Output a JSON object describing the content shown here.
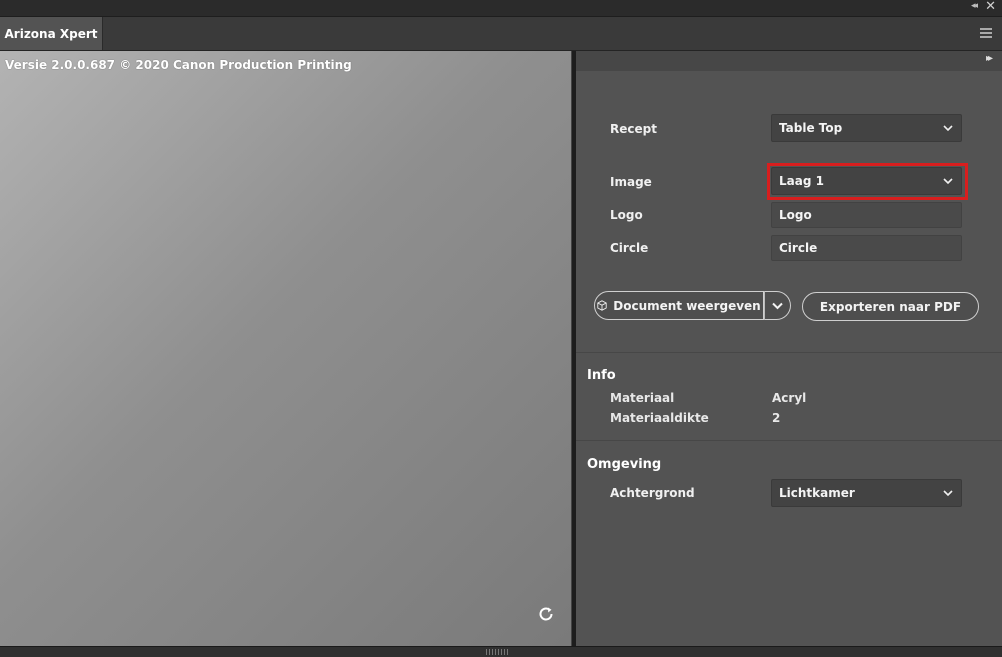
{
  "app": {
    "tab_title": "Arizona Xpert",
    "version_text": "Versie 2.0.0.687 © 2020 Canon Production Printing"
  },
  "form": {
    "recept": {
      "label": "Recept",
      "value": "Table Top"
    },
    "image": {
      "label": "Image",
      "value": "Laag 1"
    },
    "logo": {
      "label": "Logo",
      "value": "Logo"
    },
    "circle": {
      "label": "Circle",
      "value": "Circle"
    }
  },
  "actions": {
    "document_button": "Document weergeven",
    "export_button": "Exporteren naar PDF"
  },
  "info": {
    "heading": "Info",
    "rows": [
      {
        "key": "Materiaal",
        "value": "Acryl"
      },
      {
        "key": "Materiaaldikte",
        "value": "2"
      }
    ]
  },
  "environment": {
    "heading": "Omgeving",
    "background": {
      "label": "Achtergrond",
      "value": "Lichtkamer"
    }
  },
  "colors": {
    "highlight": "#d81e1e",
    "panel": "#535353"
  }
}
